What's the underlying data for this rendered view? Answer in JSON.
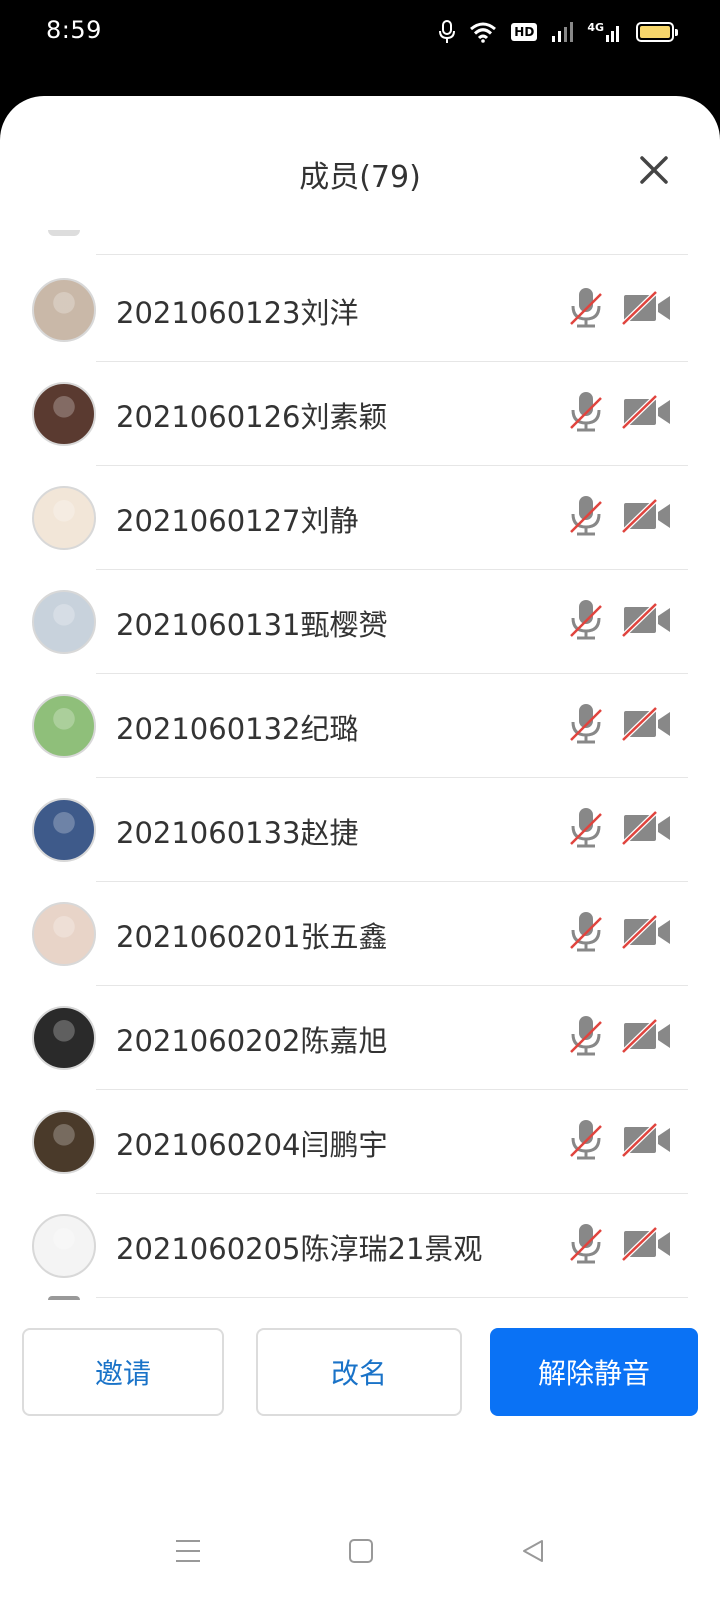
{
  "status_bar": {
    "time": "8:59",
    "hd": "HD",
    "network": "4G",
    "icons": [
      "mic-icon",
      "wifi-icon",
      "hd-icon",
      "signal-icon",
      "signal-4g-icon",
      "battery-icon"
    ]
  },
  "sheet": {
    "title": "成员(79)",
    "close_icon": "close-icon"
  },
  "members": [
    {
      "name": "2021060123刘洋",
      "avatar_color": "#c9b8a8",
      "mic": "muted",
      "camera": "off"
    },
    {
      "name": "2021060126刘素颖",
      "avatar_color": "#5a3a30",
      "mic": "muted",
      "camera": "off"
    },
    {
      "name": "2021060127刘静",
      "avatar_color": "#f2e6d8",
      "mic": "muted",
      "camera": "off"
    },
    {
      "name": "2021060131甄樱赟",
      "avatar_color": "#c8d2dc",
      "mic": "muted",
      "camera": "off"
    },
    {
      "name": "2021060132纪璐",
      "avatar_color": "#8fbf7a",
      "mic": "muted",
      "camera": "off"
    },
    {
      "name": "2021060133赵捷",
      "avatar_color": "#3e5a8a",
      "mic": "muted",
      "camera": "off"
    },
    {
      "name": "2021060201张五鑫",
      "avatar_color": "#e8d4c8",
      "mic": "muted",
      "camera": "off"
    },
    {
      "name": "2021060202陈嘉旭",
      "avatar_color": "#2a2a2a",
      "mic": "muted",
      "camera": "off"
    },
    {
      "name": "2021060204闫鹏宇",
      "avatar_color": "#4a3a2a",
      "mic": "muted",
      "camera": "off"
    },
    {
      "name": "2021060205陈淳瑞21景观",
      "avatar_color": "#f4f4f4",
      "mic": "muted",
      "camera": "off"
    }
  ],
  "buttons": {
    "invite": "邀请",
    "rename": "改名",
    "unmute": "解除静音"
  },
  "colors": {
    "primary": "#0a72f5",
    "link": "#1a73c8",
    "muted_slash": "#e0443e",
    "icon_gray": "#888888"
  },
  "nav": [
    "menu-icon",
    "home-icon",
    "back-icon"
  ]
}
